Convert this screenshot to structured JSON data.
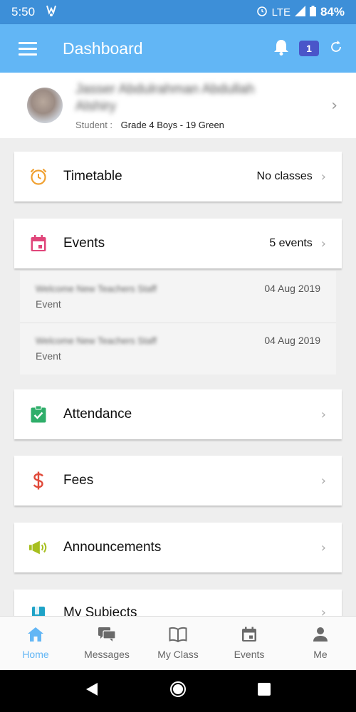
{
  "status_bar": {
    "time": "5:50",
    "network": "LTE",
    "battery": "84%"
  },
  "app_bar": {
    "title": "Dashboard",
    "notification_count": "1"
  },
  "profile": {
    "name_line1": "Jasser Abdulrahman Abdullah",
    "name_line2": "Alshiry",
    "role_label": "Student :",
    "class_name": "Grade 4 Boys - 19 Green"
  },
  "timetable": {
    "label": "Timetable",
    "value": "No classes",
    "icon": "alarm-clock-icon",
    "color": "#f0a030"
  },
  "events": {
    "label": "Events",
    "value": "5 events",
    "icon": "calendar-icon",
    "color": "#e0457a",
    "items": [
      {
        "title": "Welcome New Teachers Staff",
        "date": "04 Aug 2019",
        "type": "Event"
      },
      {
        "title": "Welcome New Teachers Staff",
        "date": "04 Aug 2019",
        "type": "Event"
      }
    ]
  },
  "attendance": {
    "label": "Attendance",
    "icon": "clipboard-check-icon",
    "color": "#2fae6a"
  },
  "fees": {
    "label": "Fees",
    "icon": "dollar-icon",
    "color": "#e04a3a"
  },
  "announcements": {
    "label": "Announcements",
    "icon": "megaphone-icon",
    "color": "#a7bf1f"
  },
  "subjects": {
    "label": "My Subjects",
    "icon": "book-icon",
    "color": "#1fa3c7"
  },
  "bottom_nav": [
    {
      "label": "Home",
      "icon": "home-icon",
      "active": true
    },
    {
      "label": "Messages",
      "icon": "messages-icon",
      "active": false
    },
    {
      "label": "My Class",
      "icon": "book-open-icon",
      "active": false
    },
    {
      "label": "Events",
      "icon": "calendar-icon",
      "active": false
    },
    {
      "label": "Me",
      "icon": "person-icon",
      "active": false
    }
  ],
  "colors": {
    "status_bar": "#3d8fd8",
    "app_bar": "#62b6f5",
    "badge": "#4a55c9",
    "accent": "#62b6f5"
  }
}
